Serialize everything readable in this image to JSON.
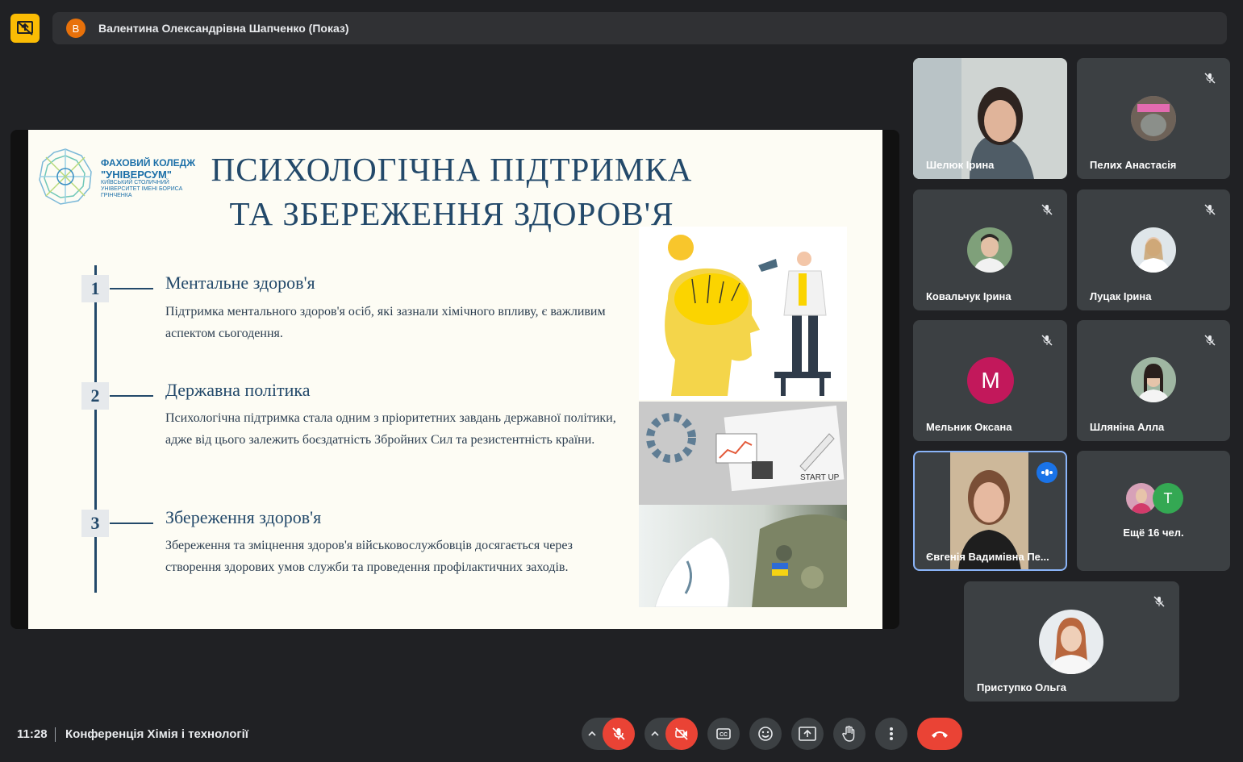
{
  "presenter": {
    "avatar_letter": "В",
    "name": "Валентина Олександрівна Шапченко (Показ)"
  },
  "slide": {
    "title_line1": "ПСИХОЛОГІЧНА ПІДТРИМКА",
    "title_line2": "ТА ЗБЕРЕЖЕННЯ ЗДОРОВ'Я",
    "logo_line1": "ФАХОВИЙ КОЛЕДЖ",
    "logo_line2": "\"УНІВЕРСУМ\"",
    "logo_line3": "КИЇВСЬКИЙ СТОЛИЧНИЙ УНІВЕРСИТЕТ ІМЕНІ БОРИСА ГРІНЧЕНКА",
    "items": [
      {
        "num": "1",
        "heading": "Ментальне здоров'я",
        "text": "Підтримка ментального здоров'я осіб, які зазнали хімічного впливу, є важливим аспектом сьогодення."
      },
      {
        "num": "2",
        "heading": "Державна політика",
        "text": "Психологічна підтримка стала одним з пріоритетних завдань державної політики, адже від цього залежить боєздатність Збройних Сил та резистентність країни."
      },
      {
        "num": "3",
        "heading": "Збереження здоров'я",
        "text": "Збереження та зміцнення здоров'я військовослужбовців досягається через створення здорових умов служби та проведення профілактичних заходів."
      }
    ],
    "startup_label": "START UP"
  },
  "participants": [
    {
      "name": "Шелюк Ірина"
    },
    {
      "name": "Пелих Анастасія"
    },
    {
      "name": "Ковальчук Ірина"
    },
    {
      "name": "Луцак Ірина"
    },
    {
      "name": "Мельник Оксана",
      "letter": "M"
    },
    {
      "name": "Шляніна Алла"
    },
    {
      "name": "Євгенія Вадимівна Пе..."
    },
    {
      "name": "Ещё 16 чел.",
      "letter": "T"
    },
    {
      "name": "Приступко Ольга"
    }
  ],
  "bottom": {
    "time": "11:28",
    "meeting": "Конференція Хімія і технології"
  },
  "colors": {
    "accent": "#fbbc04",
    "end_call": "#ea4335",
    "active_speaker": "#8ab4f8",
    "avatar_m": "#c2185b",
    "avatar_t": "#34a853"
  }
}
